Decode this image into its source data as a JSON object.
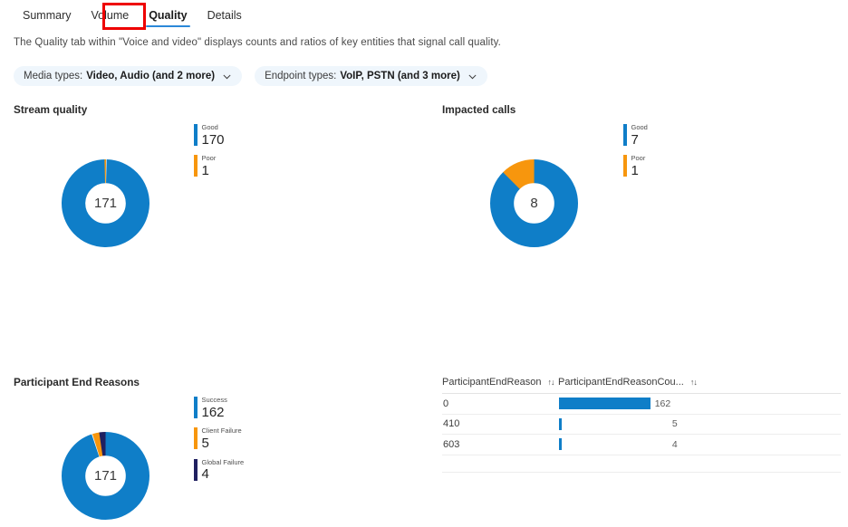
{
  "tabs": [
    {
      "label": "Summary",
      "selected": false
    },
    {
      "label": "Volume",
      "selected": false
    },
    {
      "label": "Quality",
      "selected": true
    },
    {
      "label": "Details",
      "selected": false
    }
  ],
  "description": "The Quality tab within \"Voice and video\" displays counts and ratios of key entities that signal call quality.",
  "filters": [
    {
      "name": "Media types:",
      "value": "Video, Audio (and 2 more)",
      "chevron": "chevron-down-icon"
    },
    {
      "name": "Endpoint types:",
      "value": "VoIP, PSTN (and 3 more)",
      "chevron": "chevron-down-icon"
    }
  ],
  "colors": {
    "blue": "#0F7EC8",
    "orange": "#F7960D",
    "navy": "#202060",
    "accent_tab": "#2B88D8",
    "annotation": "#EE0000",
    "pill_bg": "#EFF6FC"
  },
  "panels": {
    "stream_quality": {
      "title": "Stream quality",
      "center_total": "171"
    },
    "impacted_calls": {
      "title": "Impacted calls",
      "center_total": "8"
    },
    "participant_end_reasons": {
      "title": "Participant End Reasons",
      "center_total": "171"
    }
  },
  "table": {
    "columns": [
      {
        "label": "ParticipantEndReason",
        "sort": "↑↓"
      },
      {
        "label": "ParticipantEndReasonCou...",
        "sort": "↑↓"
      }
    ],
    "rows": [
      {
        "reason": "0",
        "count": "162"
      },
      {
        "reason": "410",
        "count": "5"
      },
      {
        "reason": "603",
        "count": "4"
      }
    ]
  },
  "chart_data": [
    {
      "type": "pie",
      "title": "Stream quality",
      "center_label": "171",
      "total": 171,
      "categories": [
        "Good",
        "Poor"
      ],
      "values": [
        170,
        1
      ],
      "colors": [
        "#0F7EC8",
        "#F7960D"
      ],
      "legend": "right"
    },
    {
      "type": "pie",
      "title": "Impacted calls",
      "center_label": "8",
      "total": 8,
      "categories": [
        "Good",
        "Poor"
      ],
      "values": [
        7,
        1
      ],
      "colors": [
        "#0F7EC8",
        "#F7960D"
      ],
      "legend": "right"
    },
    {
      "type": "pie",
      "title": "Participant End Reasons",
      "center_label": "171",
      "total": 171,
      "categories": [
        "Success",
        "Client Failure",
        "Global Failure"
      ],
      "values": [
        162,
        5,
        4
      ],
      "colors": [
        "#0F7EC8",
        "#F7960D",
        "#202060"
      ],
      "legend": "right"
    },
    {
      "type": "bar",
      "title": "ParticipantEndReason",
      "xlabel": "ParticipantEndReasonCou...",
      "ylabel": "ParticipantEndReason",
      "categories": [
        "0",
        "410",
        "603"
      ],
      "values": [
        162,
        5,
        4
      ],
      "max": 162,
      "orientation": "horizontal",
      "colors": [
        "#0F7EC8"
      ]
    }
  ]
}
